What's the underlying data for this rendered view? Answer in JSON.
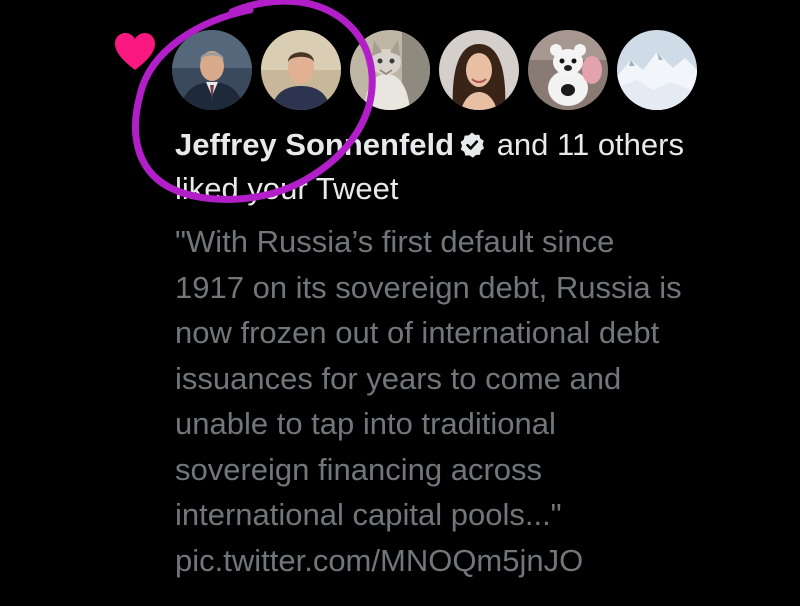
{
  "notification": {
    "type_icon": "heart-icon",
    "accent_color": "#f91880",
    "annotation_color": "#b21fc9",
    "avatars": [
      {
        "name": "avatar-man-suit",
        "icon": "person-photo"
      },
      {
        "name": "avatar-young-man",
        "icon": "person-photo"
      },
      {
        "name": "avatar-cat",
        "icon": "cat-photo"
      },
      {
        "name": "avatar-woman",
        "icon": "person-photo"
      },
      {
        "name": "avatar-plush-toy",
        "icon": "toy-photo"
      },
      {
        "name": "avatar-snowy-landscape",
        "icon": "landscape-photo"
      }
    ],
    "user_name": "Jeffrey Sonnenfeld",
    "verified_icon": "verified-badge-icon",
    "others_text": "and 11 others",
    "action_text": "liked your Tweet",
    "tweet_text": "\"With Russia’s first default since\n1917 on its sovereign debt, Russia is\nnow frozen out of international debt\nissuances for years to come and\nunable to tap into traditional\nsovereign financing across\ninternational capital pools...\"",
    "tweet_link": "pic.twitter.com/MNOQm5jnJO"
  }
}
